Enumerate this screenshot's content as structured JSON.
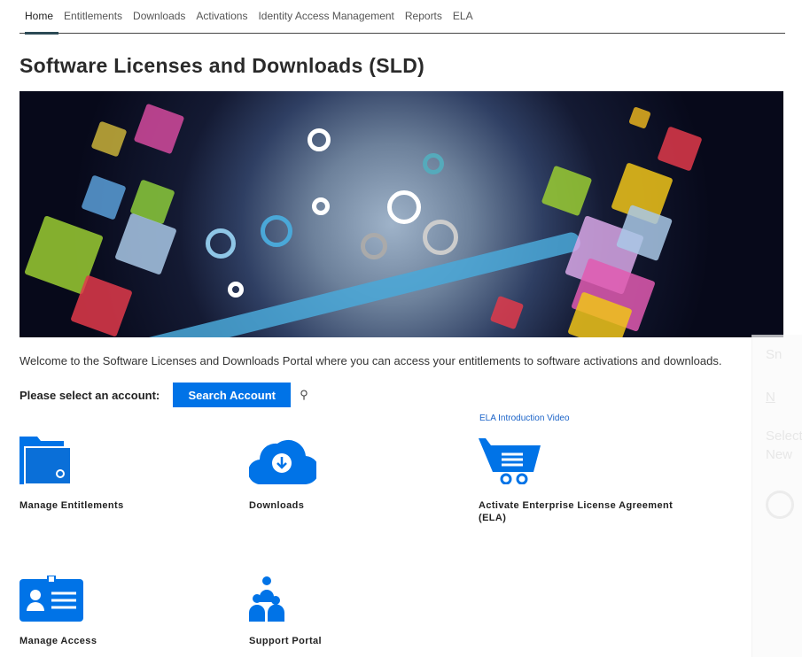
{
  "nav": {
    "items": [
      "Home",
      "Entitlements",
      "Downloads",
      "Activations",
      "Identity Access Management",
      "Reports",
      "ELA"
    ],
    "active": "Home"
  },
  "page_title": "Software Licenses and Downloads (SLD)",
  "welcome": "Welcome to the Software Licenses and Downloads Portal where you can access your entitlements to software activations and downloads.",
  "account": {
    "label": "Please select an account:",
    "button": "Search Account"
  },
  "ela_link": "ELA Introduction Video",
  "tiles": {
    "manage_entitlements": "Manage Entitlements",
    "downloads": "Downloads",
    "ela": "Activate Enterprise License Agreement (ELA)",
    "manage_access": "Manage Access",
    "support": "Support Portal"
  },
  "side_panel": {
    "line1": "Sn",
    "line2": "N",
    "line3": "Select",
    "line4": "New"
  },
  "colors": {
    "accent": "#0073e7"
  }
}
